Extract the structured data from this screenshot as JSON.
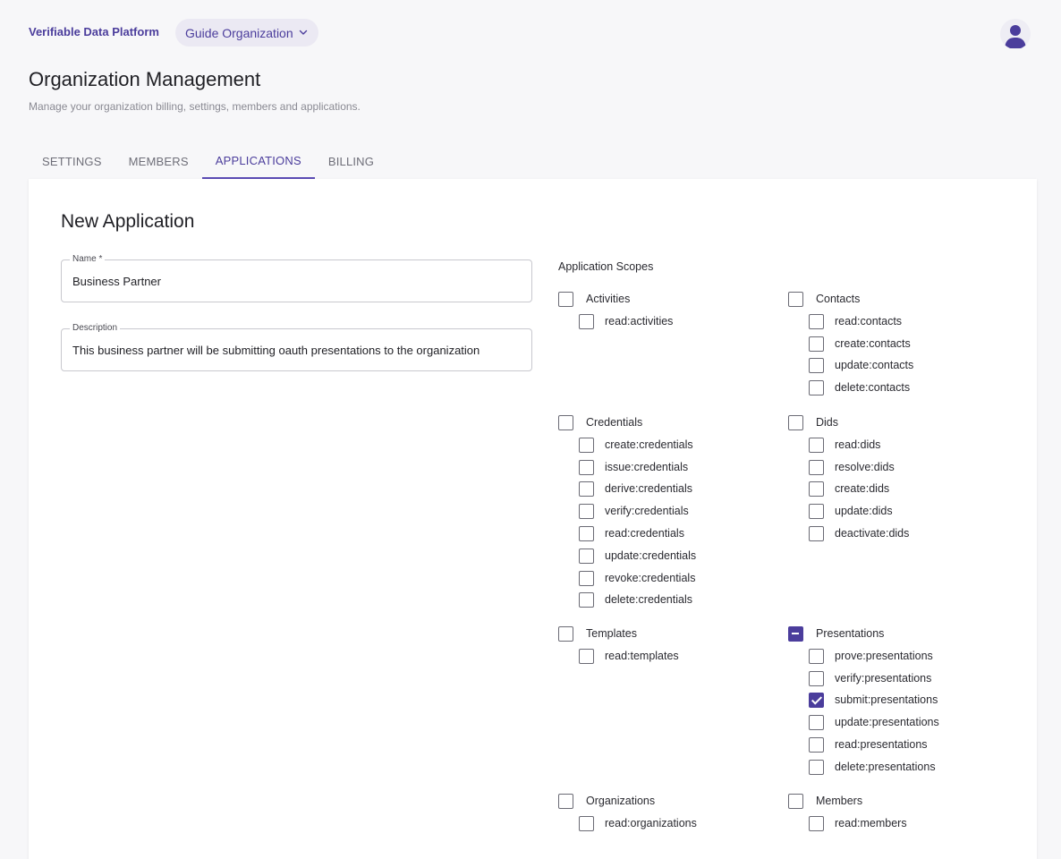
{
  "header": {
    "brand": "Verifiable Data Platform",
    "organization_selector": "Guide Organization"
  },
  "page": {
    "title": "Organization Management",
    "subtitle": "Manage your organization billing, settings, members and applications."
  },
  "tabs": [
    {
      "label": "SETTINGS",
      "active": false
    },
    {
      "label": "MEMBERS",
      "active": false
    },
    {
      "label": "APPLICATIONS",
      "active": true
    },
    {
      "label": "BILLING",
      "active": false
    }
  ],
  "form": {
    "title": "New Application",
    "name_label": "Name *",
    "name_value": "Business Partner",
    "description_label": "Description",
    "description_value": "This business partner will be submitting oauth presentations to the organization"
  },
  "scopes_title": "Application Scopes",
  "scope_groups": [
    {
      "label": "Activities",
      "state": "unchecked",
      "items": [
        {
          "label": "read:activities",
          "checked": false
        }
      ]
    },
    {
      "label": "Contacts",
      "state": "unchecked",
      "items": [
        {
          "label": "read:contacts",
          "checked": false
        },
        {
          "label": "create:contacts",
          "checked": false
        },
        {
          "label": "update:contacts",
          "checked": false
        },
        {
          "label": "delete:contacts",
          "checked": false
        }
      ]
    },
    {
      "label": "Credentials",
      "state": "unchecked",
      "items": [
        {
          "label": "create:credentials",
          "checked": false
        },
        {
          "label": "issue:credentials",
          "checked": false
        },
        {
          "label": "derive:credentials",
          "checked": false
        },
        {
          "label": "verify:credentials",
          "checked": false
        },
        {
          "label": "read:credentials",
          "checked": false
        },
        {
          "label": "update:credentials",
          "checked": false
        },
        {
          "label": "revoke:credentials",
          "checked": false
        },
        {
          "label": "delete:credentials",
          "checked": false
        }
      ]
    },
    {
      "label": "Dids",
      "state": "unchecked",
      "items": [
        {
          "label": "read:dids",
          "checked": false
        },
        {
          "label": "resolve:dids",
          "checked": false
        },
        {
          "label": "create:dids",
          "checked": false
        },
        {
          "label": "update:dids",
          "checked": false
        },
        {
          "label": "deactivate:dids",
          "checked": false
        }
      ]
    },
    {
      "label": "Templates",
      "state": "unchecked",
      "items": [
        {
          "label": "read:templates",
          "checked": false
        }
      ]
    },
    {
      "label": "Presentations",
      "state": "indeterminate",
      "items": [
        {
          "label": "prove:presentations",
          "checked": false
        },
        {
          "label": "verify:presentations",
          "checked": false
        },
        {
          "label": "submit:presentations",
          "checked": true
        },
        {
          "label": "update:presentations",
          "checked": false
        },
        {
          "label": "read:presentations",
          "checked": false
        },
        {
          "label": "delete:presentations",
          "checked": false
        }
      ]
    },
    {
      "label": "Organizations",
      "state": "unchecked",
      "items": [
        {
          "label": "read:organizations",
          "checked": false
        }
      ]
    },
    {
      "label": "Members",
      "state": "unchecked",
      "items": [
        {
          "label": "read:members",
          "checked": false
        }
      ]
    }
  ],
  "colors": {
    "accent": "#4b3d9c"
  }
}
